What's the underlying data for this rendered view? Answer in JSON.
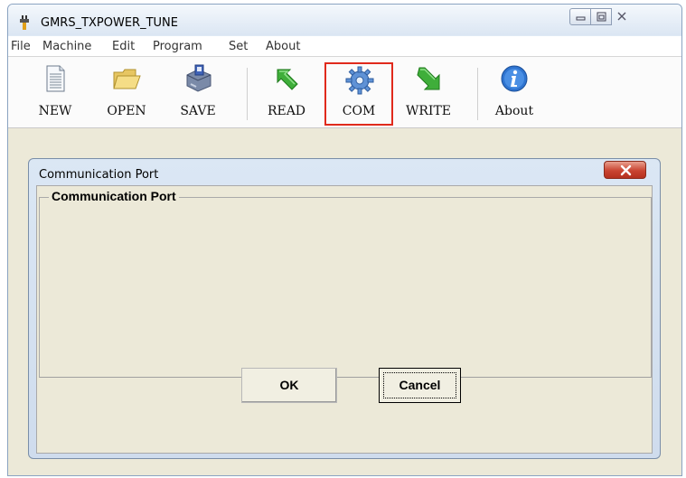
{
  "window": {
    "title": "GMRS_TXPOWER_TUNE"
  },
  "menu": [
    "File",
    "Machine",
    "Edit",
    "Program",
    "Set",
    "About"
  ],
  "toolbar": {
    "new_label": "NEW",
    "open_label": "OPEN",
    "save_label": "SAVE",
    "read_label": "READ",
    "com_label": "COM",
    "write_label": "WRITE",
    "about_label": "About",
    "icons": [
      "document-icon",
      "folder-icon",
      "floppy-save-icon",
      "read-arrow-icon",
      "gear-icon",
      "write-arrow-icon",
      "info-icon"
    ],
    "highlight_color": "#e02a1c"
  },
  "dialog": {
    "title": "Communication Port",
    "group_label": "Communication Port",
    "ok_label": "OK",
    "cancel_label": "Cancel"
  }
}
